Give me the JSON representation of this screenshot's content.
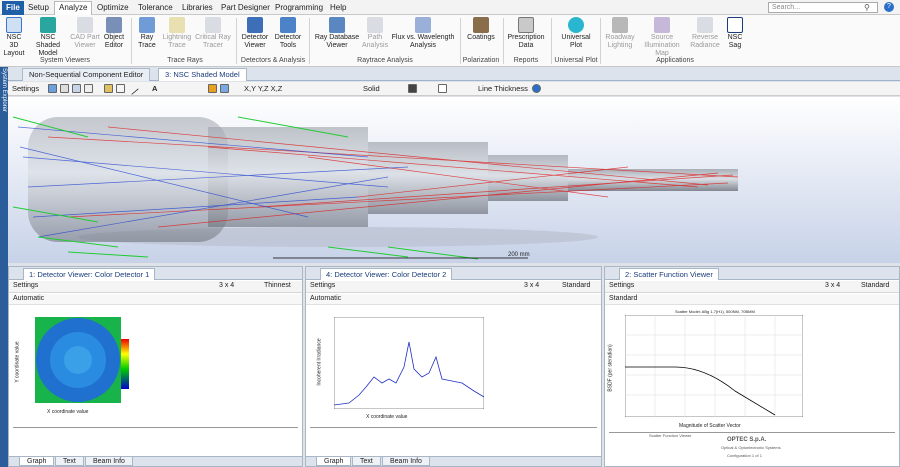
{
  "ribbon_tabs": [
    "File",
    "Setup",
    "Analyze",
    "Optimize",
    "Tolerance",
    "Libraries",
    "Part Designer",
    "Programming",
    "Help"
  ],
  "active_tab": "Analyze",
  "search_placeholder": "Search...",
  "ribbon": {
    "system_viewers": {
      "label": "System Viewers",
      "buttons": [
        "NSC 3D Layout",
        "NSC Shaded Model",
        "CAD Part Viewer",
        "Object Editor"
      ]
    },
    "trace_rays": {
      "label": "Trace Rays",
      "buttons": [
        "Ray Trace",
        "Lightning Trace",
        "Critical Ray Tracer"
      ]
    },
    "detectors": {
      "label": "Detectors & Analysis",
      "buttons": [
        "Detector Viewer",
        "Detector Tools"
      ]
    },
    "raytrace_analysis": {
      "label": "Raytrace Analysis",
      "buttons": [
        "Ray Database Viewer",
        "Path Analysis",
        "Flux vs. Wavelength Analysis"
      ]
    },
    "polarization": {
      "label": "Polarization",
      "buttons": [
        "Coatings"
      ]
    },
    "reports": {
      "label": "Reports",
      "buttons": [
        "Prescription Data"
      ]
    },
    "universal_plot": {
      "label": "Universal Plot",
      "buttons": [
        "Universal Plot"
      ]
    },
    "applications": {
      "label": "Applications",
      "buttons": [
        "Roadway Lighting",
        "Source Illumination Map",
        "Reverse Radiance",
        "NSC Sag"
      ]
    }
  },
  "side_strip": "System Explorer",
  "doc_tabs": [
    "Non-Sequential Component Editor",
    "3: NSC Shaded Model"
  ],
  "main_toolbar": {
    "settings": "Settings",
    "solid": "Solid",
    "line_thickness": "Line Thickness",
    "xyz": "X,Y  Y,Z  X,Z"
  },
  "scale_label": "200 mm",
  "panes": [
    {
      "tab": "1: Detector Viewer: Color Detector 1",
      "settings": "Settings",
      "grid": "3 x 4",
      "mode": "Thinnest",
      "sub": "Automatic",
      "xlabel": "X coordinate value",
      "ylabel": "Y coordinate value",
      "bottom_tabs": [
        "Graph",
        "Text",
        "Beam Info"
      ]
    },
    {
      "tab": "4: Detector Viewer: Color Detector 2",
      "settings": "Settings",
      "grid": "3 x 4",
      "mode": "Standard",
      "sub": "Automatic",
      "xlabel": "X coordinate value",
      "ylabel": "Incoherent Irradiance",
      "bottom_tabs": [
        "Graph",
        "Text",
        "Beam Info"
      ]
    },
    {
      "tab": "2: Scatter Function Viewer",
      "settings": "Settings",
      "grid": "3 x 4",
      "mode": "Standard",
      "sub": "Standard",
      "plot_title": "Scatter Model: ABg 1.7(H1), 500NM, 70BMM",
      "xlabel": "Magnitude of Scatter Vector",
      "ylabel": "BSDF (per steradian)",
      "company": "OPTEC S.p.A.",
      "company_sub": "Optical & Optoelectronic Systems",
      "config": "Configuration 1 of 1",
      "footer_title": "Scatter Function Viewer"
    }
  ],
  "colors": {
    "accent": "#1f5fa8",
    "panel": "#dce3ec"
  }
}
